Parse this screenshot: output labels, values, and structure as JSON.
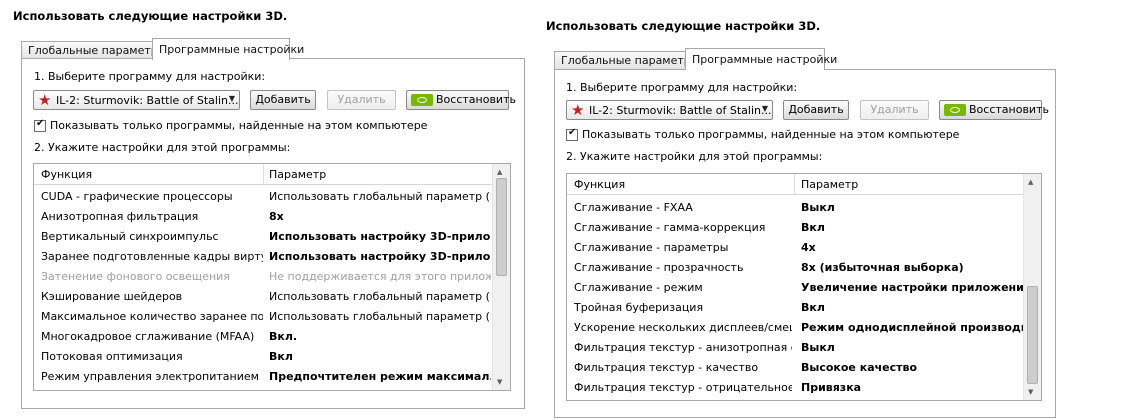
{
  "panels": [
    {
      "title": "Использовать следующие настройки 3D.",
      "tabs": [
        "Глобальные параметры",
        "Программные настройки"
      ],
      "step1": "1. Выберите программу для настройки:",
      "program": "IL-2: Sturmovik: Battle of Stalin...",
      "buttons": {
        "add": "Добавить",
        "remove": "Удалить",
        "restore": "Восстановить"
      },
      "checkbox_label": "Показывать только программы, найденные на этом компьютере",
      "step2": "2. Укажите настройки для этой программы:",
      "columns": [
        "Функция",
        "Параметр"
      ],
      "rows": [
        {
          "f": "CUDA - графические процессоры",
          "p": "Использовать глобальный параметр (Все)"
        },
        {
          "f": "Анизотропная фильтрация",
          "p": "8x"
        },
        {
          "f": "Вертикальный синхроимпульс",
          "p": "Использовать настройку 3D-прило..."
        },
        {
          "f": "Заранее подготовленные кадры вирту...",
          "p": "Использовать настройку 3D-прило..."
        },
        {
          "f": "Затенение фонового освещения",
          "p": "Не поддерживается для этого приложе..."
        },
        {
          "f": "Кэширование шейдеров",
          "p": "Использовать глобальный параметр (В..."
        },
        {
          "f": "Максимальное количество заранее под...",
          "p": "Использовать глобальный параметр (И..."
        },
        {
          "f": "Многокадровое сглаживание (MFAA)",
          "p": "Вкл."
        },
        {
          "f": "Потоковая оптимизация",
          "p": "Вкл"
        },
        {
          "f": "Режим управления электропитанием",
          "p": "Предпочтителен режим максимал..."
        }
      ]
    },
    {
      "title": "Использовать следующие настройки 3D.",
      "tabs": [
        "Глобальные параметры",
        "Программные настройки"
      ],
      "step1": "1. Выберите программу для настройки:",
      "program": "IL-2: Sturmovik: Battle of Stalin...",
      "buttons": {
        "add": "Добавить",
        "remove": "Удалить",
        "restore": "Восстановить"
      },
      "checkbox_label": "Показывать только программы, найденные на этом компьютере",
      "step2": "2. Укажите настройки для этой программы:",
      "columns": [
        "Функция",
        "Параметр"
      ],
      "rows": [
        {
          "f": "Сглаживание - FXAA",
          "p": "Выкл"
        },
        {
          "f": "Сглаживание - гамма-коррекция",
          "p": "Вкл"
        },
        {
          "f": "Сглаживание - параметры",
          "p": "4x"
        },
        {
          "f": "Сглаживание - прозрачность",
          "p": "8x (избыточная выборка)"
        },
        {
          "f": "Сглаживание - режим",
          "p": "Увеличение настройки приложения"
        },
        {
          "f": "Тройная буферизация",
          "p": "Вкл"
        },
        {
          "f": "Ускорение нескольких дисплеев/смеша...",
          "p": "Режим однодисплейной производи..."
        },
        {
          "f": "Фильтрация текстур - анизотропная оп...",
          "p": "Выкл"
        },
        {
          "f": "Фильтрация текстур - качество",
          "p": "Высокое качество"
        },
        {
          "f": "Фильтрация текстур - отрицательное о...",
          "p": "Привязка"
        }
      ]
    }
  ]
}
